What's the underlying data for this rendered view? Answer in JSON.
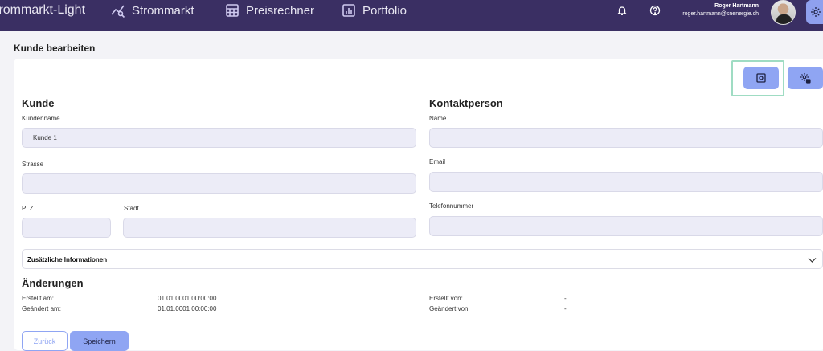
{
  "header": {
    "brand": "trommarkt-Light",
    "nav": [
      {
        "label": "Strommarkt",
        "icon": "chart-line-icon"
      },
      {
        "label": "Preisrechner",
        "icon": "calculator-icon"
      },
      {
        "label": "Portfolio",
        "icon": "bar-chart-icon"
      }
    ],
    "user": {
      "name": "Roger Hartmann",
      "email": "roger.hartmann@snenergie.ch"
    },
    "icons": [
      "bell-icon",
      "help-icon",
      "gear-icon"
    ]
  },
  "page": {
    "title": "Kunde bearbeiten"
  },
  "customer": {
    "heading": "Kunde",
    "name_label": "Kundenname",
    "name_value": "Kunde 1",
    "street_label": "Strasse",
    "street_value": "",
    "zip_label": "PLZ",
    "zip_value": "",
    "city_label": "Stadt",
    "city_value": ""
  },
  "contact": {
    "heading": "Kontaktperson",
    "name_label": "Name",
    "name_value": "",
    "email_label": "Email",
    "email_value": "",
    "phone_label": "Telefonnummer",
    "phone_value": ""
  },
  "additional": {
    "label": "Zusätzliche Informationen"
  },
  "changes": {
    "heading": "Änderungen",
    "created_at_label": "Erstellt am:",
    "created_at_value": "01.01.0001 00:00:00",
    "changed_at_label": "Geändert am:",
    "changed_at_value": "01.01.0001 00:00:00",
    "created_by_label": "Erstellt von:",
    "created_by_value": "-",
    "changed_by_label": "Geändert von:",
    "changed_by_value": "-"
  },
  "actions": {
    "back": "Zurück",
    "save": "Speichern"
  },
  "colors": {
    "header_bg": "#3a2f63",
    "accent": "#8fa5f3",
    "field_bg": "#ececf7"
  }
}
